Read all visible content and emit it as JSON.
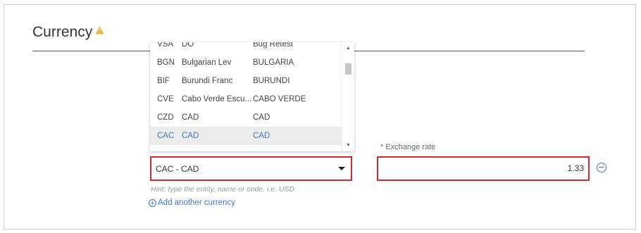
{
  "section": {
    "title": "Currency",
    "warning_icon": "warning-triangle-icon",
    "warning_color": "#f0b43a"
  },
  "dropdown": {
    "options": [
      {
        "code": "VSA",
        "name": "DO",
        "country": "Bug Retest"
      },
      {
        "code": "BGN",
        "name": "Bulgarian Lev",
        "country": "BULGARIA"
      },
      {
        "code": "BIF",
        "name": "Burundi Franc",
        "country": "BURUNDI"
      },
      {
        "code": "CVE",
        "name": "Cabo Verde Escu...",
        "country": "CABO VERDE"
      },
      {
        "code": "CZD",
        "name": "CAD",
        "country": "CAD"
      },
      {
        "code": "CAC",
        "name": "CAD",
        "country": "CAD",
        "selected": true
      }
    ],
    "scroll_up_icon": "scroll-up-arrow-icon",
    "scroll_down_icon": "scroll-down-arrow-icon"
  },
  "currency_select": {
    "value": "CAC - CAD",
    "caret_icon": "chevron-down-icon",
    "hint": "Hint: type the entity, name or code. i.e. USD"
  },
  "add_link": {
    "label": "Add another currency",
    "icon": "plus-circle-icon"
  },
  "exchange_rate": {
    "label": "* Exchange rate",
    "value": "1.33",
    "remove_icon": "minus-circle-icon"
  },
  "colors": {
    "accent": "#3a78c9",
    "error_border": "#d9262d",
    "selected_row_bg": "#ececec"
  }
}
